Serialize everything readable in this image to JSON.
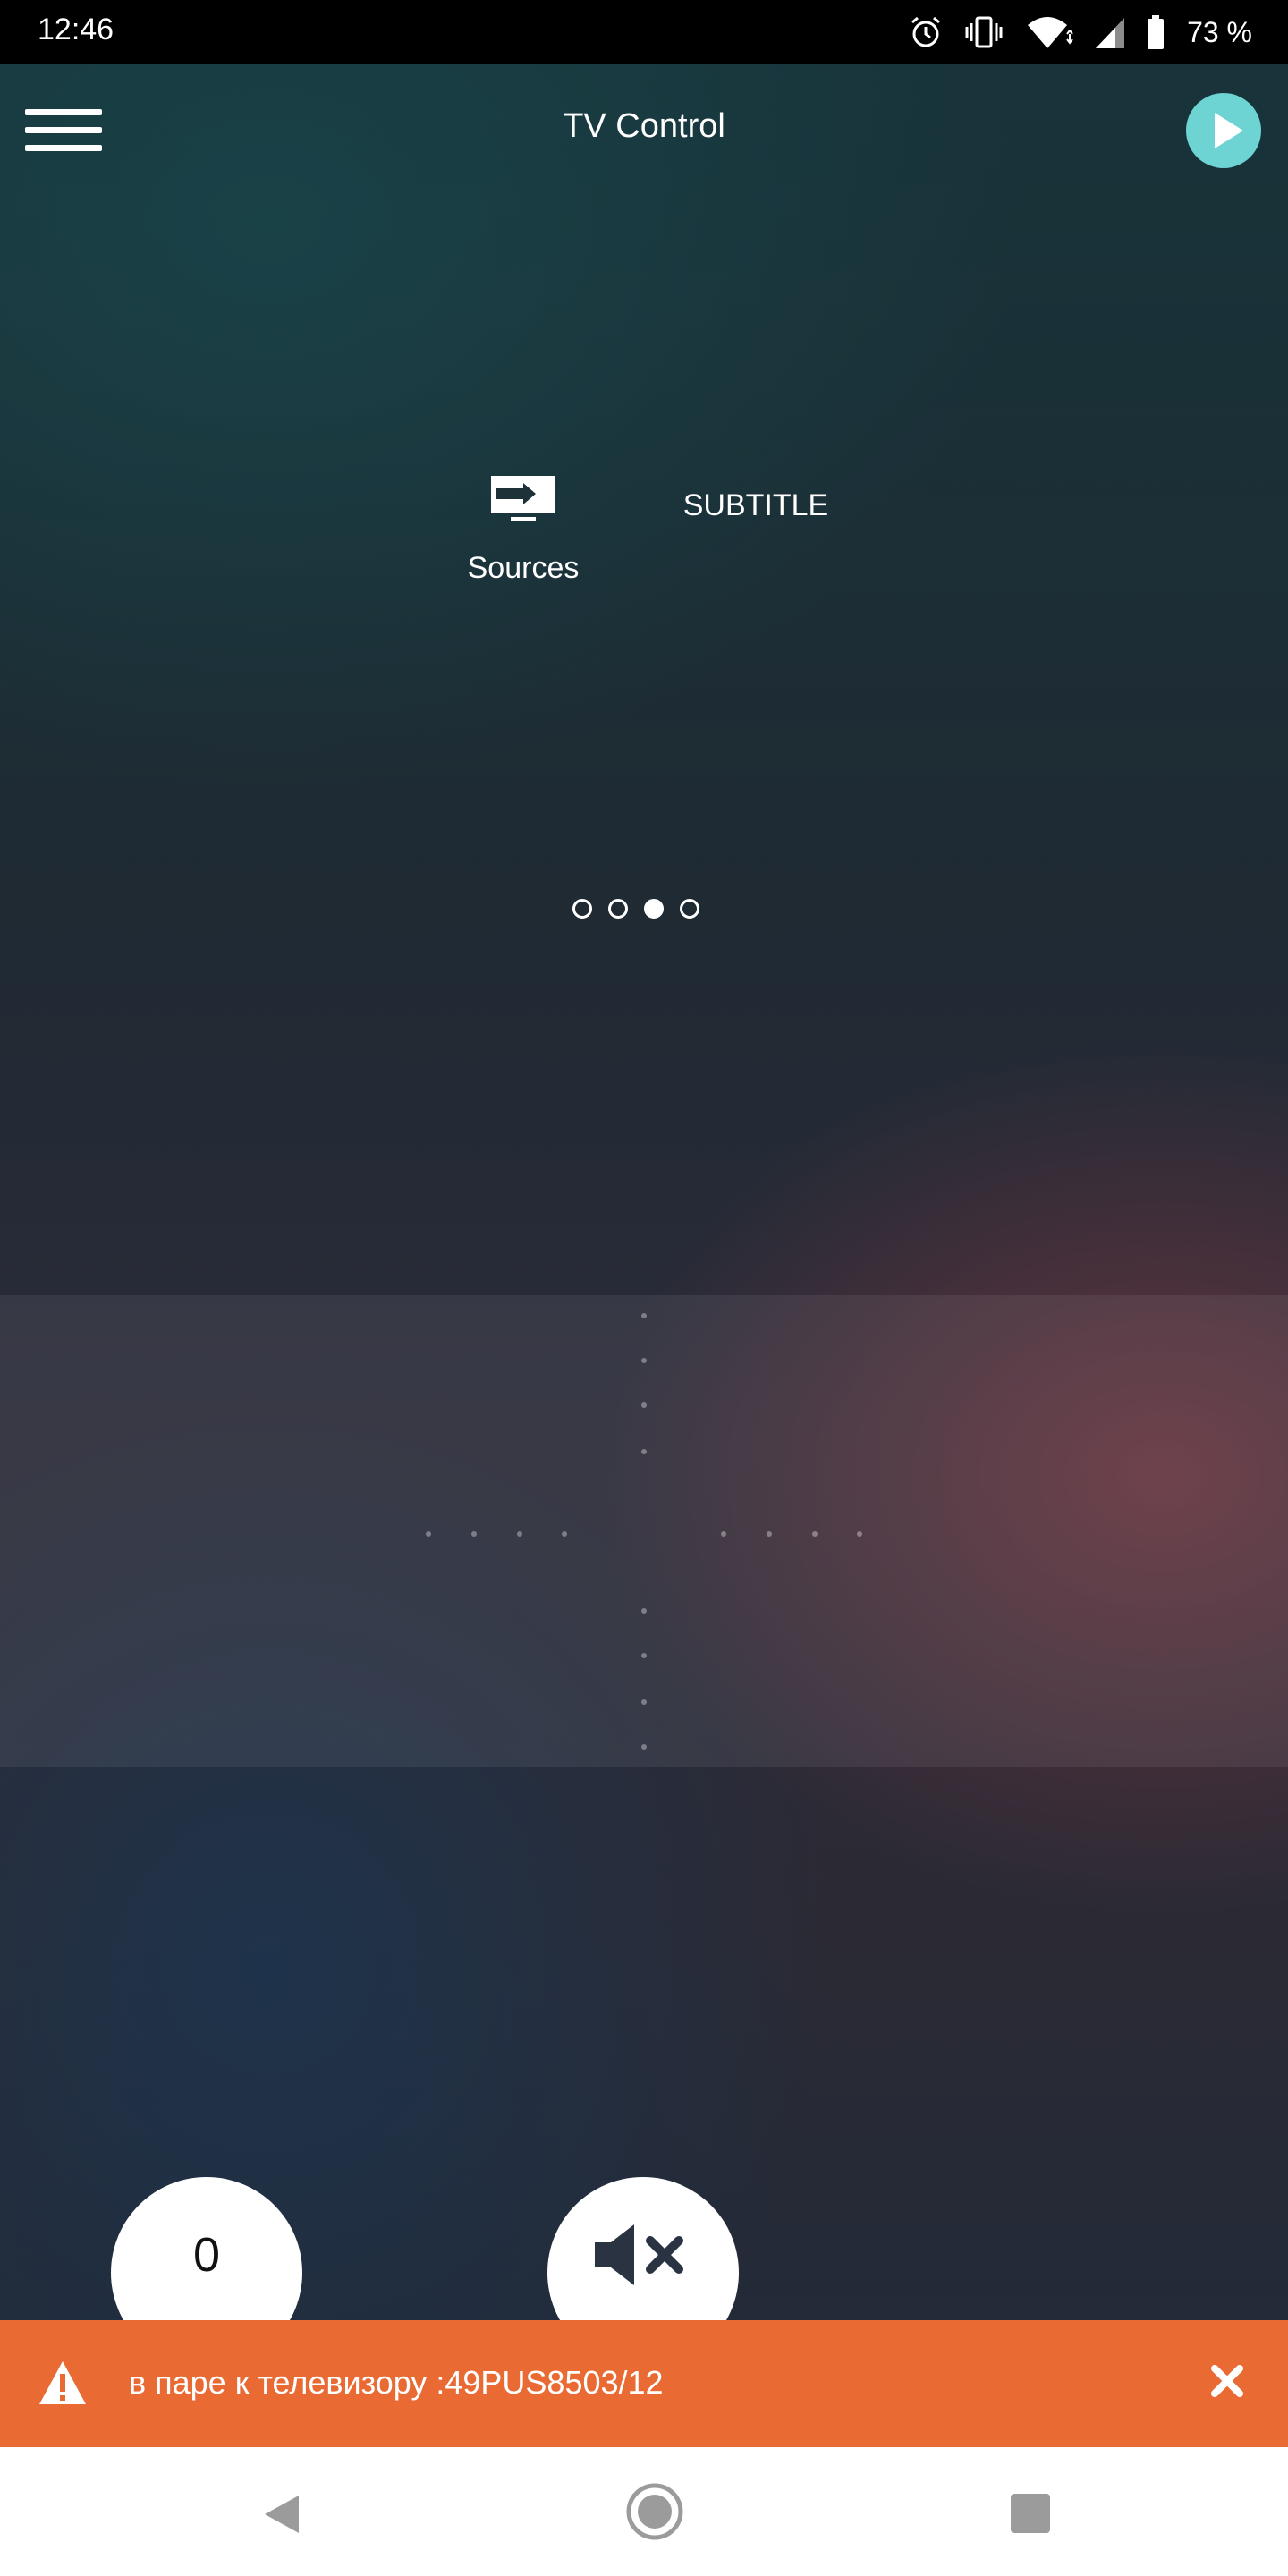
{
  "status_bar": {
    "time": "12:46",
    "battery": "73 %",
    "icons": [
      "alarm-icon",
      "vibrate-icon",
      "wifi-icon",
      "signal-icon",
      "battery-icon"
    ]
  },
  "app_bar": {
    "title": "TV Control",
    "menu_icon": "hamburger-menu-icon",
    "play_icon": "play-icon",
    "accent_color": "#6ed3d3"
  },
  "quick_actions": {
    "sources": {
      "label": "Sources",
      "icon": "tv-input-source-icon"
    },
    "subtitle": {
      "label": "SUBTITLE"
    }
  },
  "pager": {
    "page_count": 4,
    "active_index": 2
  },
  "buttons": {
    "zero_label": "0",
    "mute_icon": "mute-icon"
  },
  "snackbar": {
    "message": "в паре к телевизору :49PUS8503/12",
    "icon": "warning-icon",
    "close_icon": "close-icon",
    "color": "#e96a33"
  },
  "nav_bar": {
    "back_icon": "back-icon",
    "home_icon": "home-icon",
    "recent_icon": "recent-apps-icon"
  }
}
